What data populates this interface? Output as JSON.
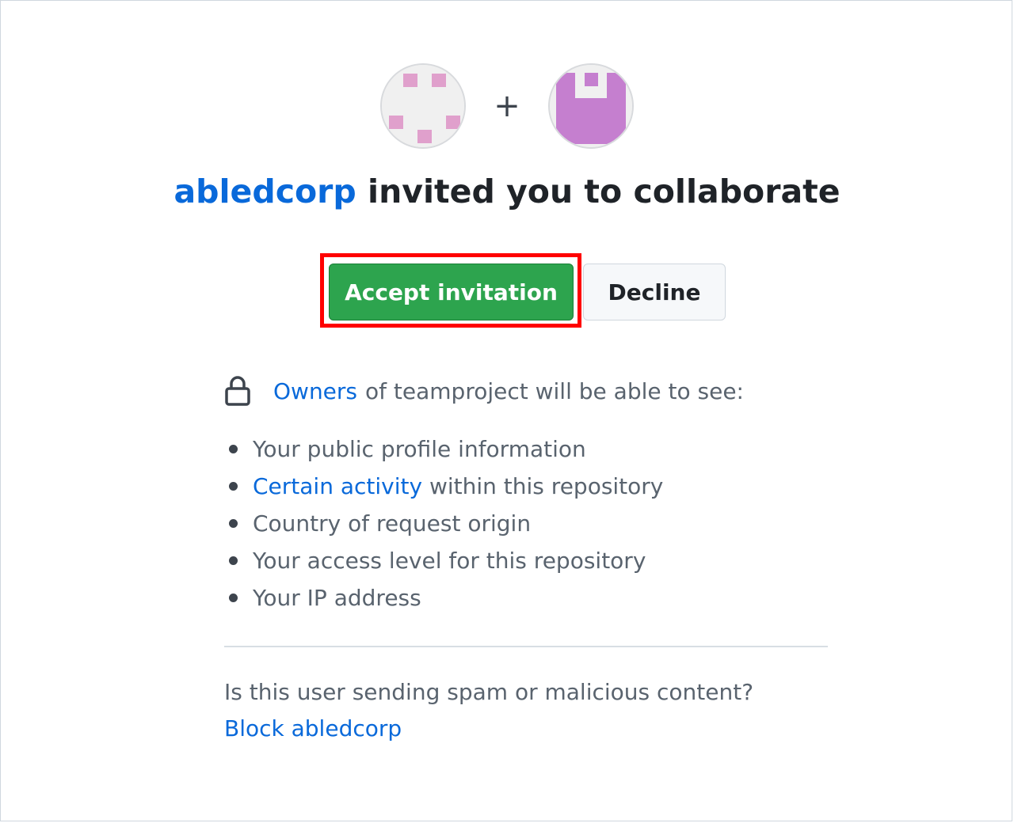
{
  "invite": {
    "inviter": "abledcorp",
    "headline_rest": "invited you to collaborate",
    "plus_symbol": "+"
  },
  "actions": {
    "accept_label": "Accept invitation",
    "decline_label": "Decline"
  },
  "visibility": {
    "icon": "lock-icon",
    "owners_link": "Owners",
    "text": "of teamproject will be able to see:"
  },
  "visible_items": [
    {
      "text": "Your public profile information"
    },
    {
      "link": "Certain activity",
      "text": "within this repository"
    },
    {
      "text": "Country of request origin"
    },
    {
      "text": "Your access level for this repository"
    },
    {
      "text": "Your IP address"
    }
  ],
  "report": {
    "question": "Is this user sending spam or malicious content?",
    "block_link": "Block abledcorp"
  },
  "colors": {
    "accent_link": "#0969da",
    "accept_green": "#2da44e",
    "highlight_red": "#ff0000",
    "avatar_left_pink": "#e0a0cc",
    "avatar_right_purple": "#c57fcf"
  }
}
